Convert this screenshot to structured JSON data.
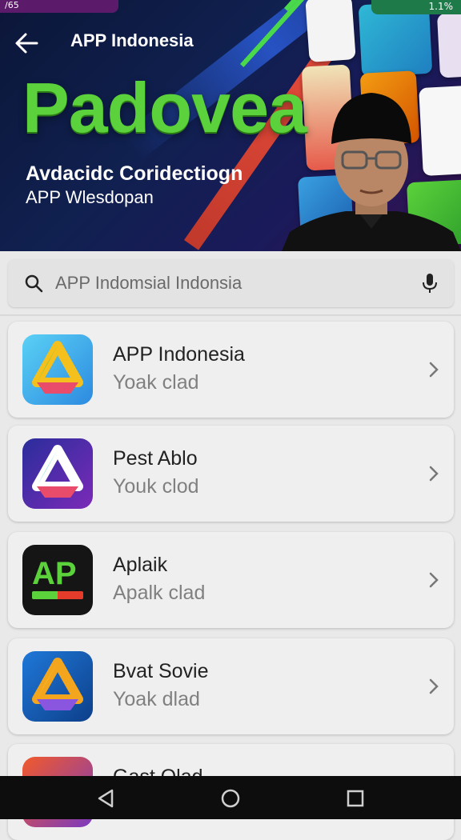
{
  "status": {
    "left_text": "/65",
    "right_text": "1.1%"
  },
  "header": {
    "app_title": "APP Indonesia",
    "big_title": "Padovea",
    "subtitle": "Avdacidc Coridectiogn",
    "tagline": "APP Wlesdopan"
  },
  "search": {
    "placeholder": "APP Indomsial Indonsia"
  },
  "apps": [
    {
      "title": "APP Indonesia",
      "subtitle": "Yoak clad"
    },
    {
      "title": "Pest Ablo",
      "subtitle": "Youk clod"
    },
    {
      "title": "Aplaik",
      "subtitle": "Apalk clad",
      "icon_text": "AP"
    },
    {
      "title": "Bvat Sovie",
      "subtitle": "Yoak dlad"
    },
    {
      "title": "Gast Olad",
      "subtitle": ""
    }
  ],
  "icons": {
    "back": "arrow-left-icon",
    "search": "search-icon",
    "mic": "mic-icon",
    "chevron": "chevron-right-icon",
    "nav_back": "triangle-back-icon",
    "nav_home": "circle-home-icon",
    "nav_recents": "square-recents-icon"
  },
  "colors": {
    "accent_green": "#5bd23b",
    "hero_bg": "#10204f",
    "navbar": "#0d0d0d"
  }
}
